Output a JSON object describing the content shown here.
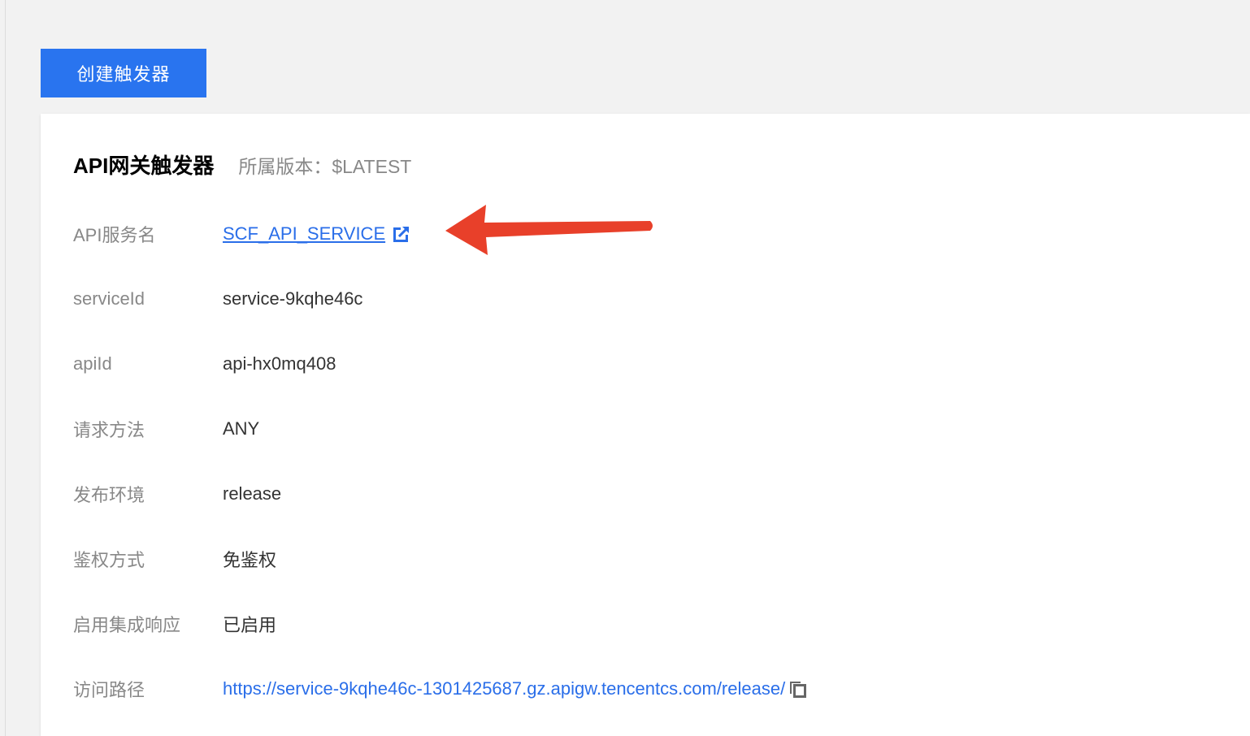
{
  "toolbar": {
    "create_trigger_label": "创建触发器"
  },
  "trigger_card": {
    "title": "API网关触发器",
    "version_text": "所属版本：$LATEST",
    "rows": [
      {
        "label": "API服务名",
        "value": "SCF_API_SERVICE"
      },
      {
        "label": "serviceId",
        "value": "service-9kqhe46c"
      },
      {
        "label": "apiId",
        "value": "api-hx0mq408"
      },
      {
        "label": "请求方法",
        "value": "ANY"
      },
      {
        "label": "发布环境",
        "value": "release"
      },
      {
        "label": "鉴权方式",
        "value": "免鉴权"
      },
      {
        "label": "启用集成响应",
        "value": "已启用"
      },
      {
        "label": "访问路径",
        "value": "https://service-9kqhe46c-1301425687.gz.apigw.tencentcs.com/release/"
      }
    ]
  },
  "icons": {
    "external_link": "external-link-icon",
    "copy": "copy-icon",
    "annotation": "red-arrow"
  },
  "colors": {
    "primary_button": "#2974ef",
    "link": "#2a6ee9",
    "annotation_arrow": "#e8402a",
    "label": "#888888",
    "value": "#333333",
    "background": "#f2f2f2"
  }
}
